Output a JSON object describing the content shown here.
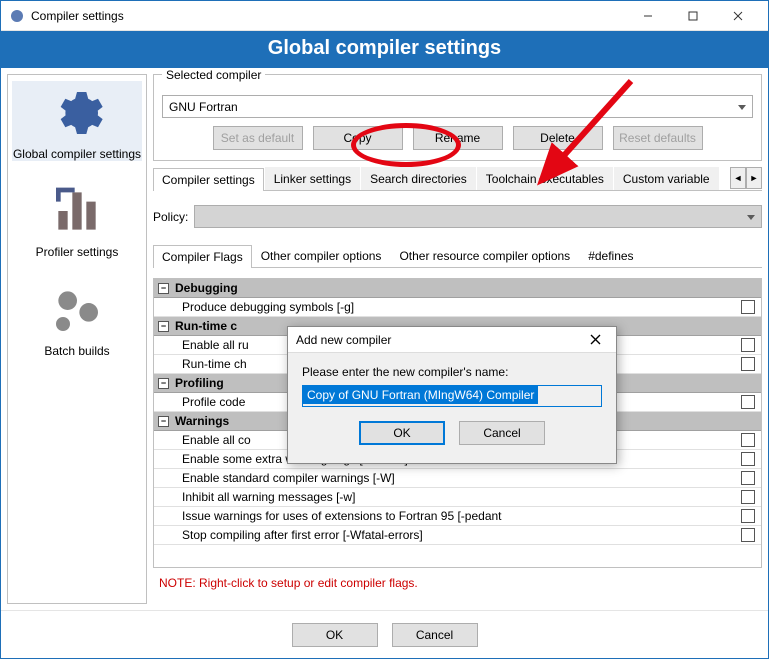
{
  "window": {
    "title": "Compiler settings",
    "banner": "Global compiler settings"
  },
  "sidebar": {
    "items": [
      {
        "label": "Global compiler settings",
        "selected": true
      },
      {
        "label": "Profiler settings",
        "selected": false
      },
      {
        "label": "Batch builds",
        "selected": false
      }
    ]
  },
  "selected_compiler": {
    "legend": "Selected compiler",
    "value": "GNU Fortran",
    "buttons": {
      "set_default": "Set as default",
      "copy": "Copy",
      "rename": "Rename",
      "delete": "Delete",
      "reset": "Reset defaults"
    }
  },
  "main_tabs": {
    "items": [
      "Compiler settings",
      "Linker settings",
      "Search directories",
      "Toolchain executables",
      "Custom variable"
    ],
    "active_index": 0
  },
  "policy": {
    "label": "Policy:",
    "value": ""
  },
  "sub_tabs": {
    "items": [
      "Compiler Flags",
      "Other compiler options",
      "Other resource compiler options",
      "#defines"
    ],
    "active_index": 0
  },
  "flag_groups": [
    {
      "name": "Debugging",
      "flags": [
        {
          "label": "Produce debugging symbols  [-g]",
          "checked": false
        }
      ]
    },
    {
      "name": "Run-time c",
      "flags": [
        {
          "label": "Enable all ru",
          "checked": false
        },
        {
          "label": "Run-time ch",
          "checked": false
        }
      ]
    },
    {
      "name": "Profiling",
      "flags": [
        {
          "label": "Profile code",
          "checked": false
        }
      ]
    },
    {
      "name": "Warnings",
      "flags": [
        {
          "label": "Enable all co",
          "checked": false
        },
        {
          "label": "Enable some extra warning flags  [-Wextra]",
          "checked": false
        },
        {
          "label": "Enable standard compiler warnings  [-W]",
          "checked": false
        },
        {
          "label": "Inhibit all warning messages  [-w]",
          "checked": false
        },
        {
          "label": "Issue warnings for uses of extensions to Fortran 95  [-pedant",
          "checked": false
        },
        {
          "label": "Stop compiling after first error  [-Wfatal-errors]",
          "checked": false
        }
      ]
    }
  ],
  "note": "NOTE: Right-click to setup or edit compiler flags.",
  "bottom": {
    "ok": "OK",
    "cancel": "Cancel"
  },
  "dialog": {
    "title": "Add new compiler",
    "prompt": "Please enter the new compiler's name:",
    "value": "Copy of GNU Fortran (MIngW64) Compiler",
    "ok": "OK",
    "cancel": "Cancel"
  }
}
